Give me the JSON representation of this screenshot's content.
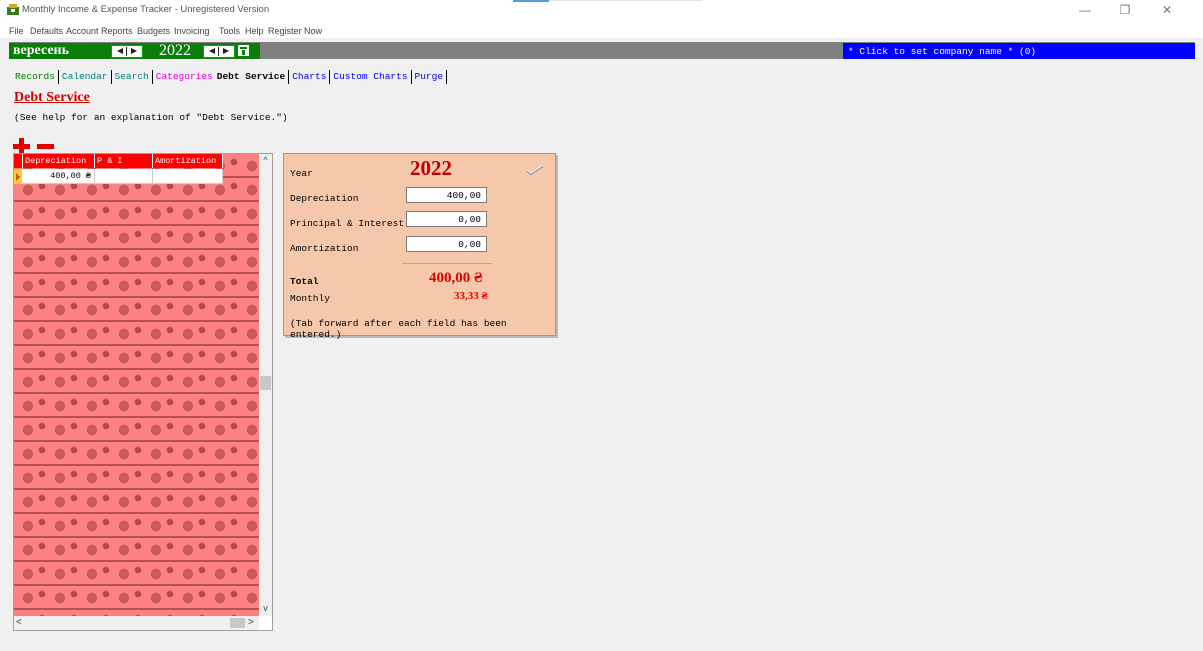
{
  "window": {
    "title": "Monthly Income & Expense Tracker - Unregistered Version",
    "controls": {
      "minimize": "—",
      "maximize": "❐",
      "close": "✕"
    }
  },
  "menu": [
    "File",
    "Defaults",
    "Account",
    "Reports",
    "Budgets",
    "Invoicing",
    "Tools",
    "Help",
    "Register Now"
  ],
  "header": {
    "month": "вересень",
    "year": "2022",
    "company": "* Click to set company name * (0)"
  },
  "tabs": [
    {
      "label": "Records",
      "color": "#008000"
    },
    {
      "label": "Calendar",
      "color": "#008080"
    },
    {
      "label": "Search",
      "color": "#008080"
    },
    {
      "label": "Categories",
      "color": "#e000e0"
    },
    {
      "label": "Debt Service",
      "color": "#000000"
    },
    {
      "label": "Charts",
      "color": "#0000ff"
    },
    {
      "label": "Custom Charts",
      "color": "#0000ff"
    },
    {
      "label": "Purge",
      "color": "#0000ff"
    }
  ],
  "page": {
    "title": "Debt Service",
    "subtitle": "(See help for an explanation of \"Debt Service.\")"
  },
  "grid": {
    "columns": [
      "Depreciation",
      "P & I",
      "Amortization"
    ],
    "rows": [
      [
        "400,00 ₴",
        "",
        ""
      ]
    ],
    "scroll": {
      "up": "^",
      "down": "v",
      "left": "<",
      "right": ">"
    }
  },
  "panel": {
    "year_label": "Year",
    "year": "2022",
    "depreciation_label": "Depreciation",
    "depreciation": "400,00",
    "pi_label": "Principal & Interest",
    "pi": "0,00",
    "amortization_label": "Amortization",
    "amortization": "0,00",
    "total_label": "Total",
    "total": "400,00 ₴",
    "monthly_label": "Monthly",
    "monthly": "33,33 ₴",
    "note": "(Tab forward after each field has been entered.)"
  },
  "icons": [
    "app-icon",
    "add-icon",
    "remove-icon",
    "save-check-icon",
    "calendar-icon"
  ],
  "colors": {
    "header_green": "#0a7d0a",
    "company_blue": "#0000ff",
    "accent_red": "#e00000",
    "panel_bg": "#f5c8ac",
    "grid_bg": "#ff8282"
  }
}
